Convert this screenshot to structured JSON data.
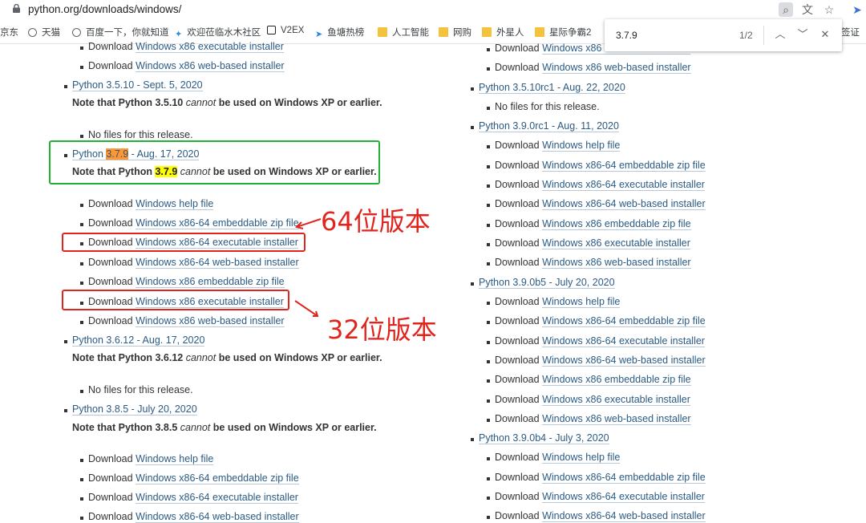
{
  "browser": {
    "url": "python.org/downloads/windows/",
    "bookmarks": [
      "京东",
      "天猫",
      "百度一下，你就知道",
      "欢迎莅临水木社区",
      "V2EX",
      "鱼塘热榜",
      "人工智能",
      "网购",
      "外星人",
      "星际争霸2",
      "签证"
    ]
  },
  "find": {
    "query": "3.7.9",
    "count": "1/2"
  },
  "left": {
    "top_items": [
      "Download |Windows x86 executable installer",
      "Download |Windows x86 web-based installer"
    ],
    "r3510": {
      "link": "Python 3.5.10 - Sept. 5, 2020",
      "note_a": "Note that Python 3.5.10 ",
      "note_em": "cannot",
      "note_b": " be used on Windows XP or earlier.",
      "nofiles": "No files for this release."
    },
    "r379": {
      "link_pre": "Python ",
      "link_ver": "3.7.9",
      "link_post": " - Aug. 17, 2020",
      "note_a": "Note that Python ",
      "note_ver": "3.7.9",
      "note_em": "cannot",
      "note_b": " be used on Windows XP or earlier."
    },
    "r379_files": [
      "Windows help file",
      "Windows x86-64 embeddable zip file",
      "Windows x86-64 executable installer",
      "Windows x86-64 web-based installer",
      "Windows x86 embeddable zip file",
      "Windows x86 executable installer",
      "Windows x86 web-based installer"
    ],
    "r3612": {
      "link": "Python 3.6.12 - Aug. 17, 2020",
      "note_a": "Note that Python 3.6.12 ",
      "note_em": "cannot",
      "note_b": " be used on Windows XP or earlier.",
      "nofiles": "No files for this release."
    },
    "r385": {
      "link": "Python 3.8.5 - July 20, 2020",
      "note_a": "Note that Python 3.8.5 ",
      "note_em": "cannot",
      "note_b": " be used on Windows XP or earlier."
    },
    "r385_files": [
      "Windows help file",
      "Windows x86-64 embeddable zip file",
      "Windows x86-64 executable installer",
      "Windows x86-64 web-based installer"
    ]
  },
  "right": {
    "top_items": [
      "Windows x86 executable installer",
      "Windows x86 web-based installer"
    ],
    "r3510rc1": {
      "link": "Python 3.5.10rc1 - Aug. 22, 2020",
      "nofiles": "No files for this release."
    },
    "r390rc1": {
      "link": "Python 3.9.0rc1 - Aug. 11, 2020"
    },
    "files7": [
      "Windows help file",
      "Windows x86-64 embeddable zip file",
      "Windows x86-64 executable installer",
      "Windows x86-64 web-based installer",
      "Windows x86 embeddable zip file",
      "Windows x86 executable installer",
      "Windows x86 web-based installer"
    ],
    "r390b5": {
      "link": "Python 3.9.0b5 - July 20, 2020"
    },
    "r390b4": {
      "link": "Python 3.9.0b4 - July 3, 2020"
    },
    "b4_files": [
      "Windows help file",
      "Windows x86-64 embeddable zip file",
      "Windows x86-64 executable installer",
      "Windows x86-64 web-based installer"
    ]
  },
  "download_word": "Download",
  "annotations": {
    "label64": "64位版本",
    "label32": "32位版本"
  },
  "colors": {
    "link": "#2b5b84",
    "green_box": "#22b132",
    "red": "#e0251f",
    "find_current": "#ff9632",
    "find_other": "#ffff00"
  }
}
